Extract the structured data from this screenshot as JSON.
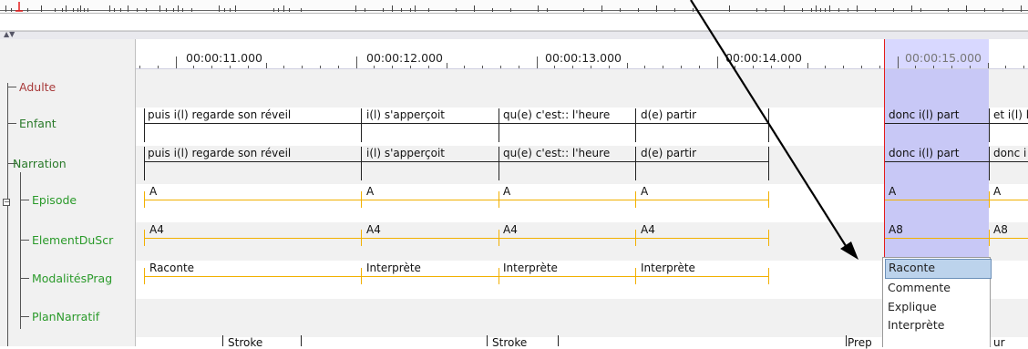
{
  "time_ruler": {
    "labels": [
      "00:00:11.000",
      "00:00:12.000",
      "00:00:13.000",
      "00:00:14.000",
      "00:00:15.000"
    ]
  },
  "tiers": [
    {
      "name": "Adulte",
      "color": "#a83a3a"
    },
    {
      "name": "Enfant",
      "color": "#2a7a2a"
    },
    {
      "name": "Narration",
      "color": "#2a7a2a"
    },
    {
      "name": "Episode",
      "color": "#2a9a2a"
    },
    {
      "name": "ElementDuScr",
      "color": "#2a9a2a"
    },
    {
      "name": "ModalitésPrag",
      "color": "#2a9a2a"
    },
    {
      "name": "PlanNarratif",
      "color": "#2a9a2a"
    }
  ],
  "annotations": {
    "enfant": [
      "puis i(l) regarde son réveil",
      "i(l) s'apperçoit",
      "qu(e) c'est:: l'heure",
      "d(e) partir",
      "donc i(l) part",
      "et i(l) l"
    ],
    "narration": [
      "puis i(l) regarde son réveil",
      "i(l) s'apperçoit",
      "qu(e) c'est:: l'heure",
      "d(e) partir",
      "donc i(l) part",
      "donc i"
    ],
    "episode": [
      "A",
      "A",
      "A",
      "A",
      "A",
      "A"
    ],
    "element": [
      "A4",
      "A4",
      "A4",
      "A4",
      "A8",
      "A8"
    ],
    "modalites": [
      "Raconte",
      "Interprète",
      "Interprète",
      "Interprète"
    ],
    "bottom": [
      "Stroke",
      "Stroke",
      "Prep",
      "ur"
    ]
  },
  "dropdown": {
    "options": [
      "Raconte",
      "Commente",
      "Explique",
      "Interprète"
    ],
    "selected": "Raconte"
  },
  "colors": {
    "selection": "#c8c8f6",
    "cursor": "#e41c1c",
    "symbolic_tier": "#f2b000",
    "time_tier": "#222222"
  }
}
